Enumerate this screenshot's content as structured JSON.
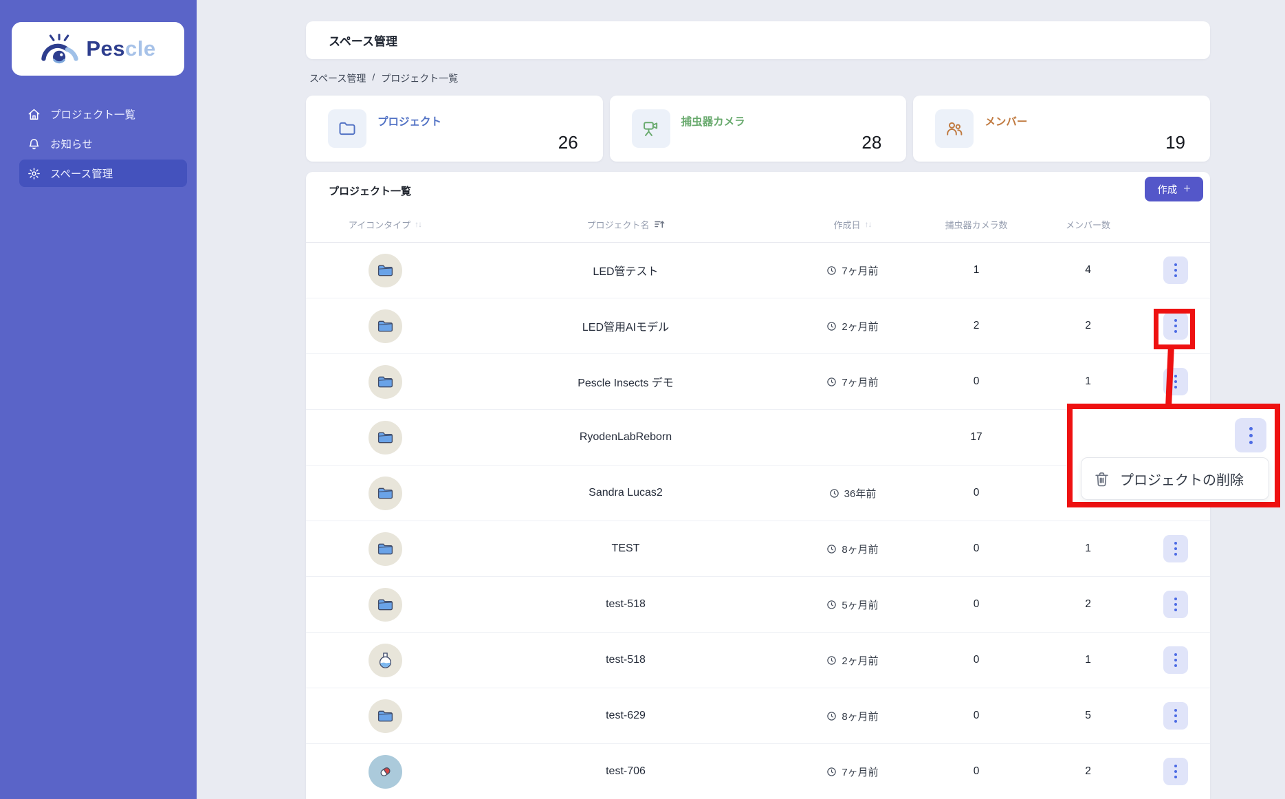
{
  "app": {
    "name": "Pescle"
  },
  "sidebar": {
    "logo_primary": "Pes",
    "logo_secondary": "cle",
    "items": [
      {
        "label": "プロジェクト一覧",
        "icon": "home-icon",
        "active": false
      },
      {
        "label": "お知らせ",
        "icon": "bell-icon",
        "active": false
      },
      {
        "label": "スペース管理",
        "icon": "gear-icon",
        "active": true
      }
    ]
  },
  "header": {
    "title": "スペース管理"
  },
  "breadcrumb": {
    "current": "スペース管理",
    "separator": "/",
    "page": "プロジェクト一覧"
  },
  "stats": [
    {
      "label": "プロジェクト",
      "value": "26",
      "icon": "folder-icon",
      "color": "#5373c5"
    },
    {
      "label": "捕虫器カメラ",
      "value": "28",
      "icon": "camera-icon",
      "color": "#69aa6e"
    },
    {
      "label": "メンバー",
      "value": "19",
      "icon": "members-icon",
      "color": "#c07a40"
    }
  ],
  "table": {
    "title": "プロジェクト一覧",
    "create_button_label": "作成",
    "create_button_plus": "+",
    "columns": [
      {
        "label": "アイコンタイプ",
        "sort": "updown"
      },
      {
        "label": "プロジェクト名",
        "sort": "asc"
      },
      {
        "label": "作成日",
        "sort": "updown"
      },
      {
        "label": "捕虫器カメラ数",
        "sort": null
      },
      {
        "label": "メンバー数",
        "sort": null
      }
    ],
    "rows": [
      {
        "icon": "folder",
        "name": "LED管テスト",
        "created": "7ヶ月前",
        "cameras": "1",
        "members": "4"
      },
      {
        "icon": "folder",
        "name": "LED管用AIモデル",
        "created": "2ヶ月前",
        "cameras": "2",
        "members": "2"
      },
      {
        "icon": "folder",
        "name": "Pescle Insects デモ",
        "created": "7ヶ月前",
        "cameras": "0",
        "members": "1"
      },
      {
        "icon": "folder",
        "name": "RyodenLabReborn",
        "created": "",
        "cameras": "17",
        "members": ""
      },
      {
        "icon": "folder",
        "name": "Sandra Lucas2",
        "created": "36年前",
        "cameras": "0",
        "members": ""
      },
      {
        "icon": "folder",
        "name": "TEST",
        "created": "8ヶ月前",
        "cameras": "0",
        "members": "1"
      },
      {
        "icon": "folder",
        "name": "test-518",
        "created": "5ヶ月前",
        "cameras": "0",
        "members": "2"
      },
      {
        "icon": "flask",
        "name": "test-518",
        "created": "2ヶ月前",
        "cameras": "0",
        "members": "1"
      },
      {
        "icon": "folder",
        "name": "test-629",
        "created": "8ヶ月前",
        "cameras": "0",
        "members": "5"
      },
      {
        "icon": "pill",
        "name": "test-706",
        "created": "7ヶ月前",
        "cameras": "0",
        "members": "2"
      }
    ]
  },
  "context_menu": {
    "delete_label": "プロジェクトの削除"
  },
  "colors": {
    "sidebar": "#5a64c8",
    "sidebar_active": "#4452bd",
    "page_background": "#e9ebf2",
    "accent_button": "#5457c9",
    "kebab_background": "#e0e4f9",
    "kebab_dots": "#4c6be4",
    "annotation_red": "#ee1111",
    "stat_blue": "#5373c5",
    "stat_green": "#69aa6e",
    "stat_orange": "#c07a40"
  }
}
